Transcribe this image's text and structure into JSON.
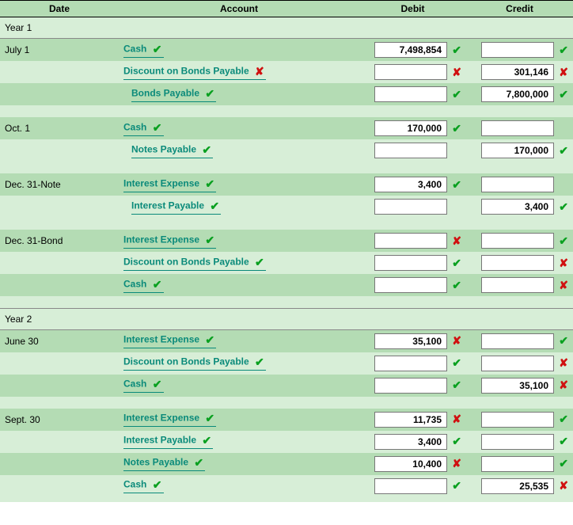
{
  "headers": {
    "date": "Date",
    "account": "Account",
    "debit": "Debit",
    "credit": "Credit"
  },
  "icons": {
    "check": "✔",
    "cross": "✘"
  },
  "entries": [
    {
      "type": "year",
      "label": "Year 1"
    },
    {
      "type": "line",
      "alt": false,
      "date": "July 1",
      "account": "Cash",
      "indent": 0,
      "acct_mark": "ok",
      "debit": "7,498,854",
      "debit_mark": "ok",
      "credit": "",
      "credit_mark": "ok"
    },
    {
      "type": "line",
      "alt": true,
      "date": "",
      "account": "Discount on Bonds Payable",
      "indent": 0,
      "acct_mark": "bad",
      "debit": "",
      "debit_mark": "bad",
      "credit": "301,146",
      "credit_mark": "bad"
    },
    {
      "type": "line",
      "alt": false,
      "date": "",
      "account": "Bonds Payable",
      "indent": 1,
      "acct_mark": "ok",
      "debit": "",
      "debit_mark": "ok",
      "credit": "7,800,000",
      "credit_mark": "ok"
    },
    {
      "type": "spacer"
    },
    {
      "type": "line",
      "alt": false,
      "date": "Oct. 1",
      "account": "Cash",
      "indent": 0,
      "acct_mark": "ok",
      "debit": "170,000",
      "debit_mark": "ok",
      "credit": "",
      "credit_mark": ""
    },
    {
      "type": "line",
      "alt": true,
      "date": "",
      "account": "Notes Payable",
      "indent": 1,
      "acct_mark": "ok",
      "debit": "",
      "debit_mark": "",
      "credit": "170,000",
      "credit_mark": "ok"
    },
    {
      "type": "spacer"
    },
    {
      "type": "line",
      "alt": false,
      "date": "Dec. 31-Note",
      "account": "Interest Expense",
      "indent": 0,
      "acct_mark": "ok",
      "debit": "3,400",
      "debit_mark": "ok",
      "credit": "",
      "credit_mark": ""
    },
    {
      "type": "line",
      "alt": true,
      "date": "",
      "account": "Interest Payable",
      "indent": 1,
      "acct_mark": "ok",
      "debit": "",
      "debit_mark": "",
      "credit": "3,400",
      "credit_mark": "ok"
    },
    {
      "type": "spacer"
    },
    {
      "type": "line",
      "alt": false,
      "date": "Dec. 31-Bond",
      "account": "Interest Expense",
      "indent": 0,
      "acct_mark": "ok",
      "debit": "",
      "debit_mark": "bad",
      "credit": "",
      "credit_mark": "ok"
    },
    {
      "type": "line",
      "alt": true,
      "date": "",
      "account": "Discount on Bonds Payable",
      "indent": 0,
      "acct_mark": "ok",
      "debit": "",
      "debit_mark": "ok",
      "credit": "",
      "credit_mark": "bad"
    },
    {
      "type": "line",
      "alt": false,
      "date": "",
      "account": "Cash",
      "indent": 0,
      "acct_mark": "ok",
      "debit": "",
      "debit_mark": "ok",
      "credit": "",
      "credit_mark": "bad"
    },
    {
      "type": "spacer"
    },
    {
      "type": "year",
      "label": "Year 2"
    },
    {
      "type": "line",
      "alt": false,
      "date": "June 30",
      "account": "Interest Expense",
      "indent": 0,
      "acct_mark": "ok",
      "debit": "35,100",
      "debit_mark": "bad",
      "credit": "",
      "credit_mark": "ok"
    },
    {
      "type": "line",
      "alt": true,
      "date": "",
      "account": "Discount on Bonds Payable",
      "indent": 0,
      "acct_mark": "ok",
      "debit": "",
      "debit_mark": "ok",
      "credit": "",
      "credit_mark": "bad"
    },
    {
      "type": "line",
      "alt": false,
      "date": "",
      "account": "Cash",
      "indent": 0,
      "acct_mark": "ok",
      "debit": "",
      "debit_mark": "ok",
      "credit": "35,100",
      "credit_mark": "bad"
    },
    {
      "type": "spacer"
    },
    {
      "type": "line",
      "alt": false,
      "date": "Sept. 30",
      "account": "Interest Expense",
      "indent": 0,
      "acct_mark": "ok",
      "debit": "11,735",
      "debit_mark": "bad",
      "credit": "",
      "credit_mark": "ok"
    },
    {
      "type": "line",
      "alt": true,
      "date": "",
      "account": "Interest Payable",
      "indent": 0,
      "acct_mark": "ok",
      "debit": "3,400",
      "debit_mark": "ok",
      "credit": "",
      "credit_mark": "ok"
    },
    {
      "type": "line",
      "alt": false,
      "date": "",
      "account": "Notes Payable",
      "indent": 0,
      "acct_mark": "ok",
      "debit": "10,400",
      "debit_mark": "bad",
      "credit": "",
      "credit_mark": "ok"
    },
    {
      "type": "line",
      "alt": true,
      "date": "",
      "account": "Cash",
      "indent": 0,
      "acct_mark": "ok",
      "debit": "",
      "debit_mark": "ok",
      "credit": "25,535",
      "credit_mark": "bad"
    },
    {
      "type": "thin-spacer"
    }
  ]
}
